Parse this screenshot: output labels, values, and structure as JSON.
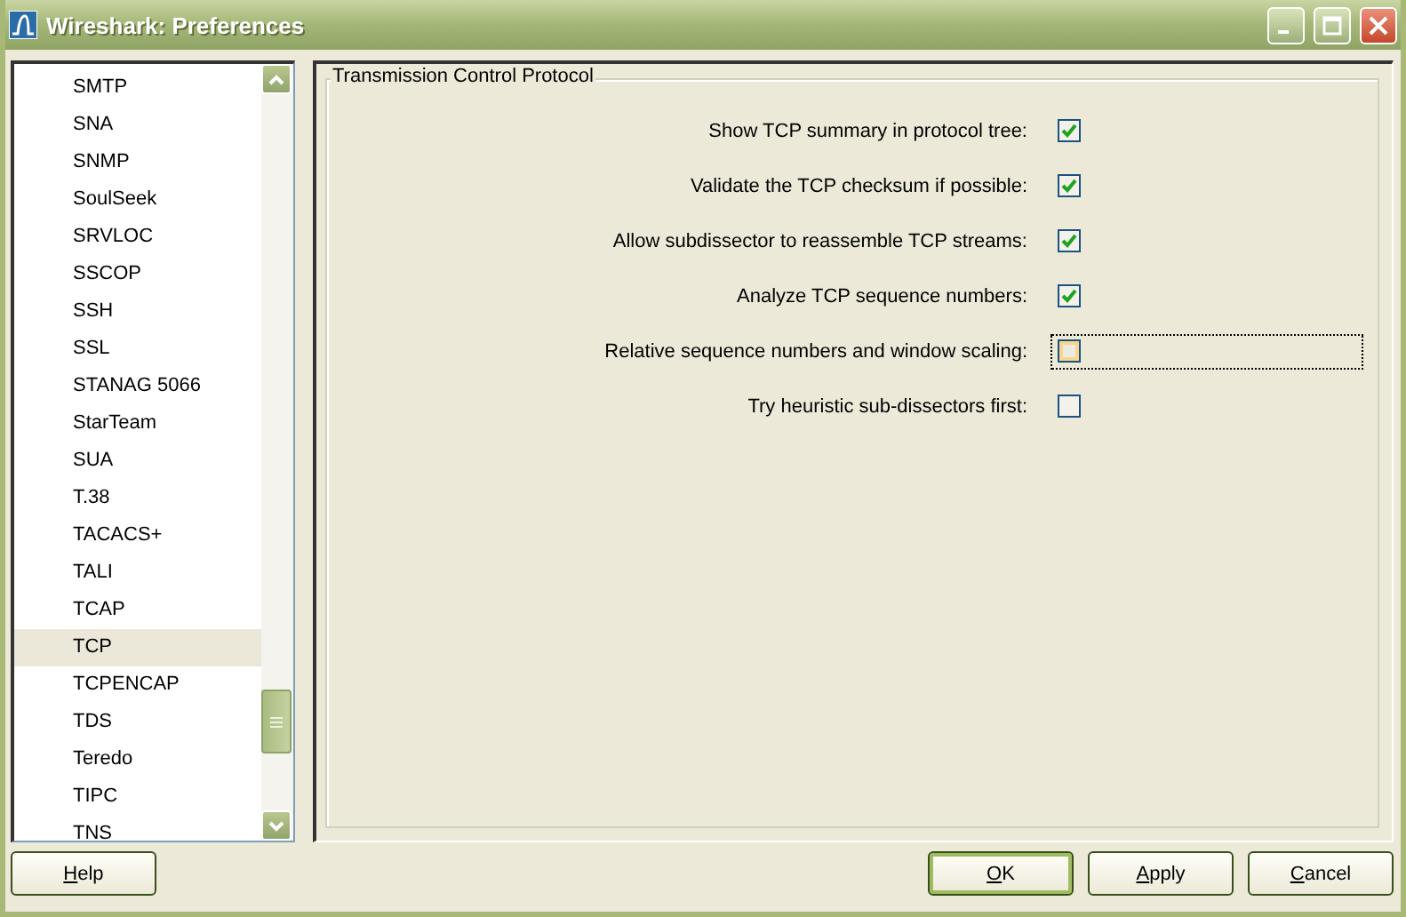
{
  "window": {
    "title": "Wireshark: Preferences"
  },
  "protocols": [
    {
      "label": "SMTP",
      "selected": false
    },
    {
      "label": "SNA",
      "selected": false
    },
    {
      "label": "SNMP",
      "selected": false
    },
    {
      "label": "SoulSeek",
      "selected": false
    },
    {
      "label": "SRVLOC",
      "selected": false
    },
    {
      "label": "SSCOP",
      "selected": false
    },
    {
      "label": "SSH",
      "selected": false
    },
    {
      "label": "SSL",
      "selected": false
    },
    {
      "label": "STANAG 5066",
      "selected": false
    },
    {
      "label": "StarTeam",
      "selected": false
    },
    {
      "label": "SUA",
      "selected": false
    },
    {
      "label": "T.38",
      "selected": false
    },
    {
      "label": "TACACS+",
      "selected": false
    },
    {
      "label": "TALI",
      "selected": false
    },
    {
      "label": "TCAP",
      "selected": false
    },
    {
      "label": "TCP",
      "selected": true
    },
    {
      "label": "TCPENCAP",
      "selected": false
    },
    {
      "label": "TDS",
      "selected": false
    },
    {
      "label": "Teredo",
      "selected": false
    },
    {
      "label": "TIPC",
      "selected": false
    },
    {
      "label": "TNS",
      "selected": false
    }
  ],
  "group": {
    "title": "Transmission Control Protocol",
    "options": [
      {
        "label": "Show TCP summary in protocol tree:",
        "checked": true,
        "focused": false
      },
      {
        "label": "Validate the TCP checksum if possible:",
        "checked": true,
        "focused": false
      },
      {
        "label": "Allow subdissector to reassemble TCP streams:",
        "checked": true,
        "focused": false
      },
      {
        "label": "Analyze TCP sequence numbers:",
        "checked": true,
        "focused": false
      },
      {
        "label": "Relative sequence numbers and window scaling:",
        "checked": false,
        "focused": true
      },
      {
        "label": "Try heuristic sub-dissectors first:",
        "checked": false,
        "focused": false
      }
    ]
  },
  "buttons": {
    "help": "Help",
    "actions": [
      {
        "label": "OK",
        "default": true
      },
      {
        "label": "Apply",
        "default": false
      },
      {
        "label": "Cancel",
        "default": false
      }
    ]
  }
}
